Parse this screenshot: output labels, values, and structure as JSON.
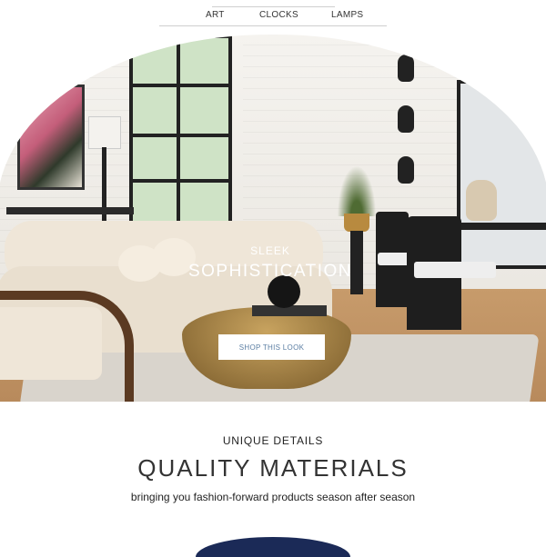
{
  "nav": {
    "items": [
      {
        "label": "ART"
      },
      {
        "label": "CLOCKS"
      },
      {
        "label": "LAMPS"
      }
    ]
  },
  "hero": {
    "kicker": "SLEEK",
    "title": "SOPHISTICATION",
    "button_label": "SHOP THIS LOOK",
    "text_color": "#ffffff",
    "button_text_color": "#5b7ea3"
  },
  "details": {
    "kicker": "UNIQUE DETAILS",
    "title": "QUALITY MATERIALS",
    "subtitle": "bringing you fashion-forward products season after season"
  },
  "colors": {
    "accent_dark_navy": "#1b2a57"
  }
}
